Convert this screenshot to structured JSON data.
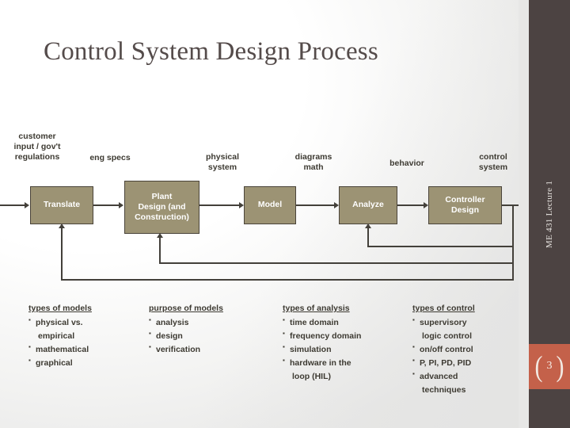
{
  "slide": {
    "title": "Control System Design Process",
    "sidebar_label": "ME 431 Lecture 1",
    "page_number": "3",
    "bracket_left": "(",
    "bracket_right": ")",
    "accent_color": "#c4614a",
    "sidebar_color": "#4c4342",
    "box_fill": "#9c9374",
    "line_color": "#43403a",
    "title_color": "#544b4a"
  },
  "diagram": {
    "boxes": [
      {
        "id": "translate",
        "label": "Translate"
      },
      {
        "id": "plant-design",
        "label_line1": "Plant",
        "label_line2": "Design (and",
        "label_line3": "Construction)"
      },
      {
        "id": "model",
        "label": "Model"
      },
      {
        "id": "analyze",
        "label": "Analyze"
      },
      {
        "id": "controller-design",
        "label_line1": "Controller",
        "label_line2": "Design"
      }
    ],
    "flow_labels": [
      {
        "id": "customer-input",
        "line1": "customer",
        "line2": "input / gov't",
        "line3": "regulations"
      },
      {
        "id": "eng-specs",
        "line1": "eng specs"
      },
      {
        "id": "physical-system",
        "line1": "physical",
        "line2": "system"
      },
      {
        "id": "diagrams-math",
        "line1": "diagrams",
        "line2": "math"
      },
      {
        "id": "behavior",
        "line1": "behavior"
      },
      {
        "id": "control-system",
        "line1": "control",
        "line2": "system"
      }
    ]
  },
  "lists": [
    {
      "id": "types-of-models",
      "header": "types of models",
      "items": [
        {
          "text": "physical vs.",
          "cont": "empirical"
        },
        {
          "text": "mathematical"
        },
        {
          "text": "graphical"
        }
      ]
    },
    {
      "id": "purpose-of-models",
      "header": "purpose of models",
      "items": [
        {
          "text": "analysis"
        },
        {
          "text": "design"
        },
        {
          "text": "verification"
        }
      ]
    },
    {
      "id": "types-of-analysis",
      "header": "types of analysis",
      "items": [
        {
          "text": "time domain"
        },
        {
          "text": "frequency domain"
        },
        {
          "text": "simulation"
        },
        {
          "text": "hardware in the",
          "cont": "loop (HIL)"
        }
      ]
    },
    {
      "id": "types-of-control",
      "header": "types of control",
      "items": [
        {
          "text": "supervisory",
          "cont": "logic control"
        },
        {
          "text": "on/off control"
        },
        {
          "text": "P, PI, PD, PID"
        },
        {
          "text": "advanced",
          "cont": "techniques"
        }
      ]
    }
  ]
}
